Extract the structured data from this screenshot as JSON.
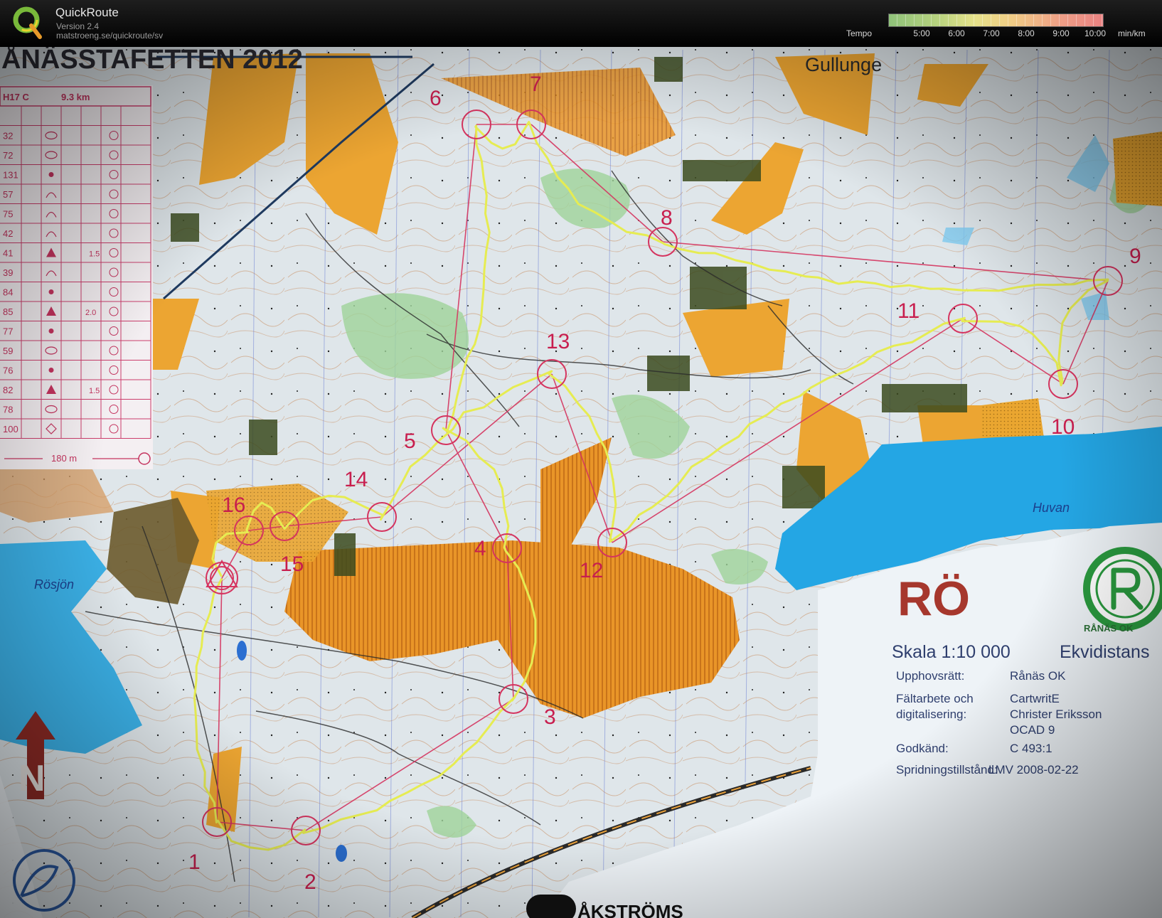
{
  "app": {
    "title": "QuickRoute",
    "version": "Version 2.4",
    "url": "matstroeng.se/quickroute/sv"
  },
  "tempo": {
    "label": "Tempo",
    "ticks": [
      "5:00",
      "6:00",
      "7:00",
      "8:00",
      "9:00",
      "10:00"
    ],
    "unit": "min/km"
  },
  "map": {
    "event_title": "ÅNÄSSTAFETTEN 2012",
    "place_names": [
      "Gullunge",
      "Rösjön",
      "Huvan"
    ],
    "control_numbers": [
      "1",
      "2",
      "3",
      "4",
      "5",
      "6",
      "7",
      "8",
      "9",
      "10",
      "11",
      "12",
      "13",
      "14",
      "15",
      "16"
    ],
    "club_code": "RÖ",
    "club_ring": "RÅNÄS OK",
    "scale": "Skala 1:10 000",
    "contour": "Ekvidistans",
    "credits": [
      {
        "label": "Upphovsrätt:",
        "value": "Rånäs OK"
      },
      {
        "label": "Fältarbete och",
        "value": "CartwritE"
      },
      {
        "label": "digitalisering:",
        "value": "Christer Eriksson"
      },
      {
        "label": "",
        "value": "OCAD 9"
      },
      {
        "label": "Godkänd:",
        "value": "C 493:1"
      },
      {
        "label": "Spridningstillstånd:",
        "value": "LMV 2008-02-22"
      }
    ],
    "north_letter": "N",
    "sponsor": "ÅKSTRÖMS",
    "description_sheet": {
      "class": "H17 C",
      "length": "9.3 km",
      "codes": [
        "32",
        "72",
        "131",
        "57",
        "75",
        "42",
        "41",
        "39",
        "84",
        "85",
        "77",
        "59",
        "76",
        "82",
        "78",
        "100"
      ],
      "extras": {
        "6": "1.5",
        "9": "2.0",
        "13": "1.5"
      },
      "finish_distance": "180 m"
    },
    "colors": {
      "route": "#e6ec52",
      "course": "#d5345f",
      "open_land": "#f0a830",
      "water": "#28a9e4",
      "forest": "#ecf1ee",
      "paper": "#eef2f4"
    }
  }
}
